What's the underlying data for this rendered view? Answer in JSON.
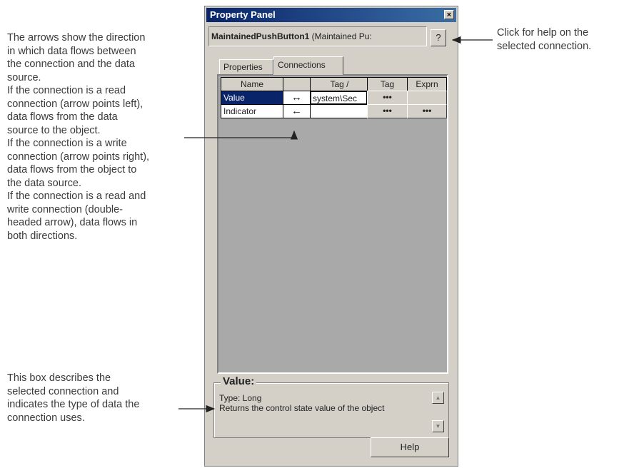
{
  "annotations": {
    "left_top": [
      "The arrows show the direction",
      "in which data flows between",
      "the connection and the data",
      "source.",
      "If the connection is a read",
      "connection (arrow points left),",
      "data flows from the data",
      "source to the object.",
      "If the connection is a write",
      "connection (arrow points right),",
      "data flows from the object to",
      "the data source.",
      "If the connection is a read and",
      "write connection (double-",
      "headed arrow), data flows in",
      "both directions."
    ],
    "left_bottom": [
      "This box describes the",
      "selected connection and",
      "indicates the type of data the",
      "connection uses."
    ],
    "right": [
      "Click for help on the",
      "selected connection."
    ]
  },
  "panel": {
    "title": "Property Panel",
    "close_glyph": "×",
    "object_name_bold": "MaintainedPushButton1",
    "object_type": " (Maintained Pu:",
    "help_glyph": "?",
    "tabs": [
      "Properties",
      "Connections"
    ],
    "active_tab": "Connections",
    "columns": [
      "Name",
      "",
      "Tag /",
      "Tag",
      "Exprn"
    ],
    "rows": [
      {
        "name": "Value",
        "arrow": "↔",
        "tag": "system\\Sec",
        "tag_btn": "•••",
        "expr_btn": ""
      },
      {
        "name": "Indicator",
        "arrow": "←",
        "tag": "",
        "tag_btn": "•••",
        "expr_btn": "•••"
      }
    ],
    "description": {
      "title": "Value:",
      "type_line": "Type: Long",
      "body": "Returns the control state value of the object"
    },
    "help_button": "Help"
  },
  "colors": {
    "title_bar": "#0a246a",
    "selection": "#0a246a",
    "panel_bg": "#d4d0c8",
    "grid_bg": "#a9a9a9"
  }
}
